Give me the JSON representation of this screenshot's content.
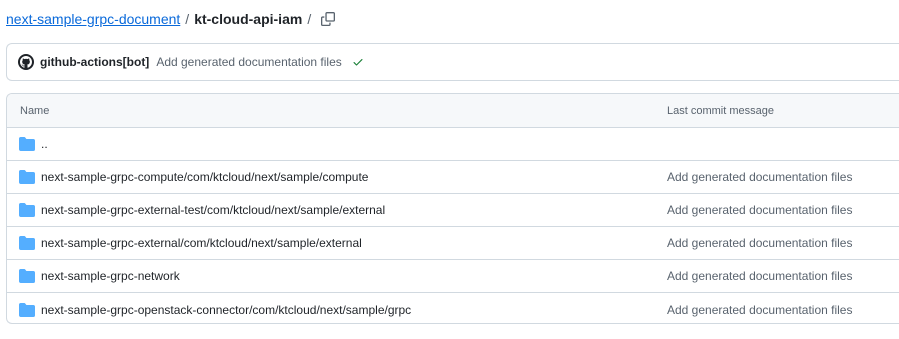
{
  "breadcrumb": {
    "repo": "next-sample-grpc-document",
    "separator": "/",
    "current": "kt-cloud-api-iam",
    "trailing_sep": "/",
    "copy_icon": "copy-icon"
  },
  "commit": {
    "author": "github-actions[bot]",
    "message": "Add generated documentation files",
    "status_icon": "check-icon",
    "status_color": "#1a7f37"
  },
  "table": {
    "headers": {
      "name": "Name",
      "message": "Last commit message"
    },
    "rows": [
      {
        "name": "..",
        "message": ""
      },
      {
        "name": "next-sample-grpc-compute/com/ktcloud/next/sample/compute",
        "message": "Add generated documentation files"
      },
      {
        "name": "next-sample-grpc-external-test/com/ktcloud/next/sample/external",
        "message": "Add generated documentation files"
      },
      {
        "name": "next-sample-grpc-external/com/ktcloud/next/sample/external",
        "message": "Add generated documentation files"
      },
      {
        "name": "next-sample-grpc-network",
        "message": "Add generated documentation files"
      },
      {
        "name": "next-sample-grpc-openstack-connector/com/ktcloud/next/sample/grpc",
        "message": "Add generated documentation files"
      }
    ],
    "folder_color": "#54aeff"
  }
}
